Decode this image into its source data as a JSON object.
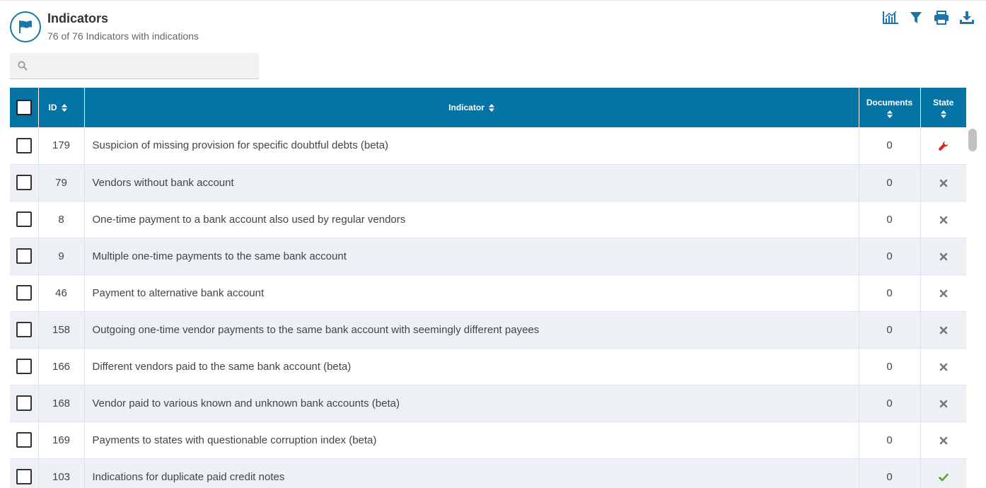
{
  "header": {
    "icon": "flag-icon",
    "title": "Indicators",
    "subtitle": "76 of 76 Indicators with indications"
  },
  "toolbar": {
    "items": [
      "chart-icon",
      "filter-icon",
      "print-icon",
      "download-icon"
    ]
  },
  "search": {
    "value": "",
    "placeholder": ""
  },
  "table": {
    "columns": {
      "id": "ID",
      "indicator": "Indicator",
      "documents": "Documents",
      "state": "State"
    },
    "rows": [
      {
        "id": "179",
        "name": "Suspicion of missing provision for specific doubtful debts (beta)",
        "documents": "0",
        "state": "wrench-icon"
      },
      {
        "id": "79",
        "name": "Vendors without bank account",
        "documents": "0",
        "state": "cross-icon"
      },
      {
        "id": "8",
        "name": "One-time payment to a bank account also used by regular vendors",
        "documents": "0",
        "state": "cross-icon"
      },
      {
        "id": "9",
        "name": "Multiple one-time payments to the same bank account",
        "documents": "0",
        "state": "cross-icon"
      },
      {
        "id": "46",
        "name": "Payment to alternative bank account",
        "documents": "0",
        "state": "cross-icon"
      },
      {
        "id": "158",
        "name": "Outgoing one-time vendor payments to the same bank account with seemingly different payees",
        "documents": "0",
        "state": "cross-icon"
      },
      {
        "id": "166",
        "name": "Different vendors paid to the same bank account (beta)",
        "documents": "0",
        "state": "cross-icon"
      },
      {
        "id": "168",
        "name": "Vendor paid to various known and unknown bank accounts (beta)",
        "documents": "0",
        "state": "cross-icon"
      },
      {
        "id": "169",
        "name": "Payments to states with questionable corruption index (beta)",
        "documents": "0",
        "state": "cross-icon"
      },
      {
        "id": "103",
        "name": "Indications for duplicate paid credit notes",
        "documents": "0",
        "state": "check-icon"
      }
    ]
  },
  "colors": {
    "header_bg": "#0673a5",
    "accent": "#1a76a8",
    "row_alt": "#edf1f5",
    "state_wrench": "#e02020",
    "state_cross": "#777777",
    "state_check": "#5aa33a"
  }
}
